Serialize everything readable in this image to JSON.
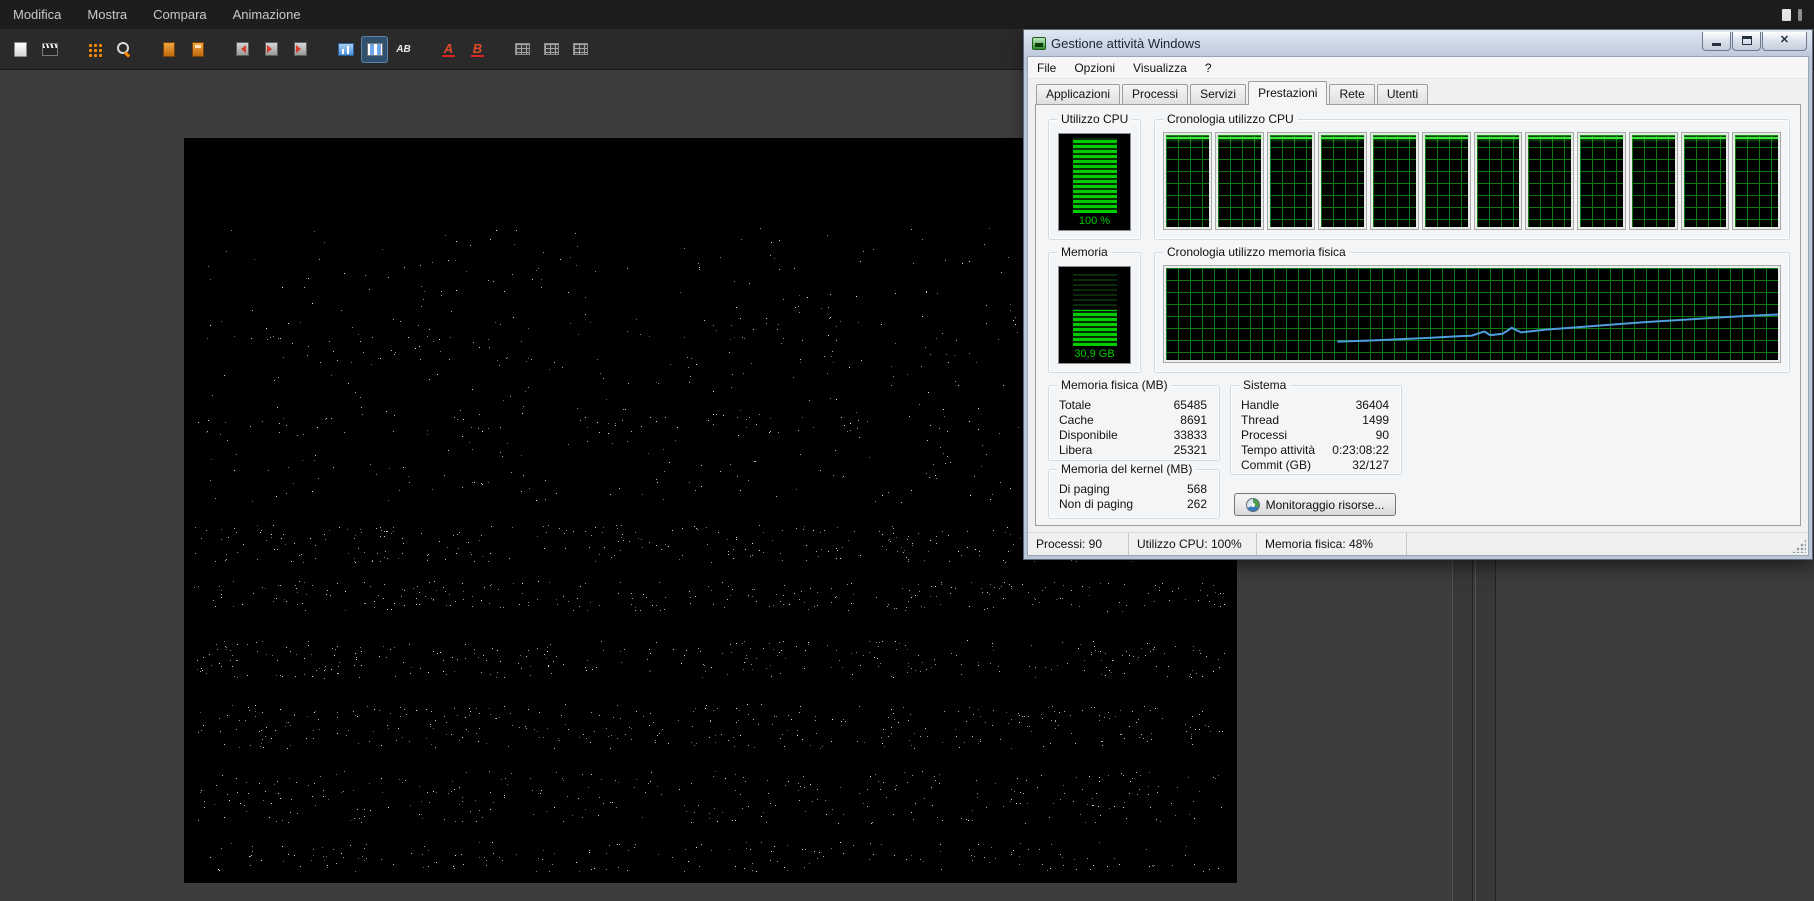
{
  "app": {
    "menu": [
      "Modifica",
      "Mostra",
      "Compara",
      "Animazione"
    ],
    "toolbar_icons": [
      {
        "name": "new-scene-icon",
        "style": "page"
      },
      {
        "name": "clapperboard-icon",
        "style": "clapper"
      },
      {
        "name": "dot-grid-icon",
        "style": "grid-o",
        "gap": true
      },
      {
        "name": "search-icon",
        "style": "search-o"
      },
      {
        "name": "panel-import-icon",
        "style": "door1",
        "gap": true
      },
      {
        "name": "panel-export-icon",
        "style": "door2"
      },
      {
        "name": "flag-back-icon",
        "style": "flag rev",
        "gap": true
      },
      {
        "name": "flag-mid-icon",
        "style": "flag"
      },
      {
        "name": "flag-forward-icon",
        "style": "flag"
      },
      {
        "name": "chart-view-icon",
        "style": "chart",
        "gap": true
      },
      {
        "name": "columns-view-icon",
        "style": "cols",
        "selected": true
      },
      {
        "name": "text-ab-icon",
        "style": "ab",
        "glyph": "AB"
      },
      {
        "name": "font-a-icon",
        "style": "a-red",
        "glyph": "A",
        "gap": true
      },
      {
        "name": "font-b-icon",
        "style": "b-red",
        "glyph": "B"
      },
      {
        "name": "table-small-icon",
        "style": "table",
        "gap": true
      },
      {
        "name": "table-medium-icon",
        "style": "table"
      },
      {
        "name": "table-large-icon",
        "style": "table"
      }
    ]
  },
  "task_manager": {
    "title": "Gestione attività Windows",
    "menu": [
      "File",
      "Opzioni",
      "Visualizza",
      "?"
    ],
    "tabs": [
      {
        "label": "Applicazioni",
        "active": false
      },
      {
        "label": "Processi",
        "active": false
      },
      {
        "label": "Servizi",
        "active": false
      },
      {
        "label": "Prestazioni",
        "active": true
      },
      {
        "label": "Rete",
        "active": false
      },
      {
        "label": "Utenti",
        "active": false
      }
    ],
    "cpu_meter": {
      "label": "Utilizzo CPU",
      "value": "100 %",
      "percent": 100
    },
    "cpu_history": {
      "label": "Cronologia utilizzo CPU",
      "panel_count": 12
    },
    "memory_meter": {
      "label": "Memoria",
      "value": "30,9 GB",
      "percent": 48
    },
    "memory_history": {
      "label": "Cronologia utilizzo memoria fisica",
      "points": [
        [
          28,
          80
        ],
        [
          33,
          79
        ],
        [
          38,
          77.5
        ],
        [
          43,
          76
        ],
        [
          47,
          74.5
        ],
        [
          50,
          73.5
        ],
        [
          52,
          69
        ],
        [
          53,
          73
        ],
        [
          55,
          71.5
        ],
        [
          56.5,
          65
        ],
        [
          58,
          70
        ],
        [
          62,
          67
        ],
        [
          67,
          64.5
        ],
        [
          72,
          62
        ],
        [
          78,
          59
        ],
        [
          84,
          56.5
        ],
        [
          90,
          54
        ],
        [
          95,
          52
        ],
        [
          100,
          50.5
        ]
      ]
    },
    "physical_memory": {
      "title": "Memoria fisica (MB)",
      "rows": [
        {
          "label": "Totale",
          "value": "65485"
        },
        {
          "label": "Cache",
          "value": "8691"
        },
        {
          "label": "Disponibile",
          "value": "33833"
        },
        {
          "label": "Libera",
          "value": "25321"
        }
      ]
    },
    "kernel_memory": {
      "title": "Memoria del kernel (MB)",
      "rows": [
        {
          "label": "Di paging",
          "value": "568"
        },
        {
          "label": "Non di paging",
          "value": "262"
        }
      ]
    },
    "system": {
      "title": "Sistema",
      "rows": [
        {
          "label": "Handle",
          "value": "36404"
        },
        {
          "label": "Thread",
          "value": "1499"
        },
        {
          "label": "Processi",
          "value": "90"
        },
        {
          "label": "Tempo attività",
          "value": "0:23:08:22"
        },
        {
          "label": "Commit (GB)",
          "value": "32/127"
        }
      ]
    },
    "resource_monitor_button": "Monitoraggio risorse...",
    "status_bar": [
      "Processi: 90",
      "Utilizzo CPU: 100%",
      "Memoria fisica: 48%"
    ]
  },
  "colors": {
    "grid_green": "#0d7a0d",
    "bright_green": "#39e839",
    "meter_green": "#00cc00",
    "memory_line": "#4f9ddb"
  }
}
